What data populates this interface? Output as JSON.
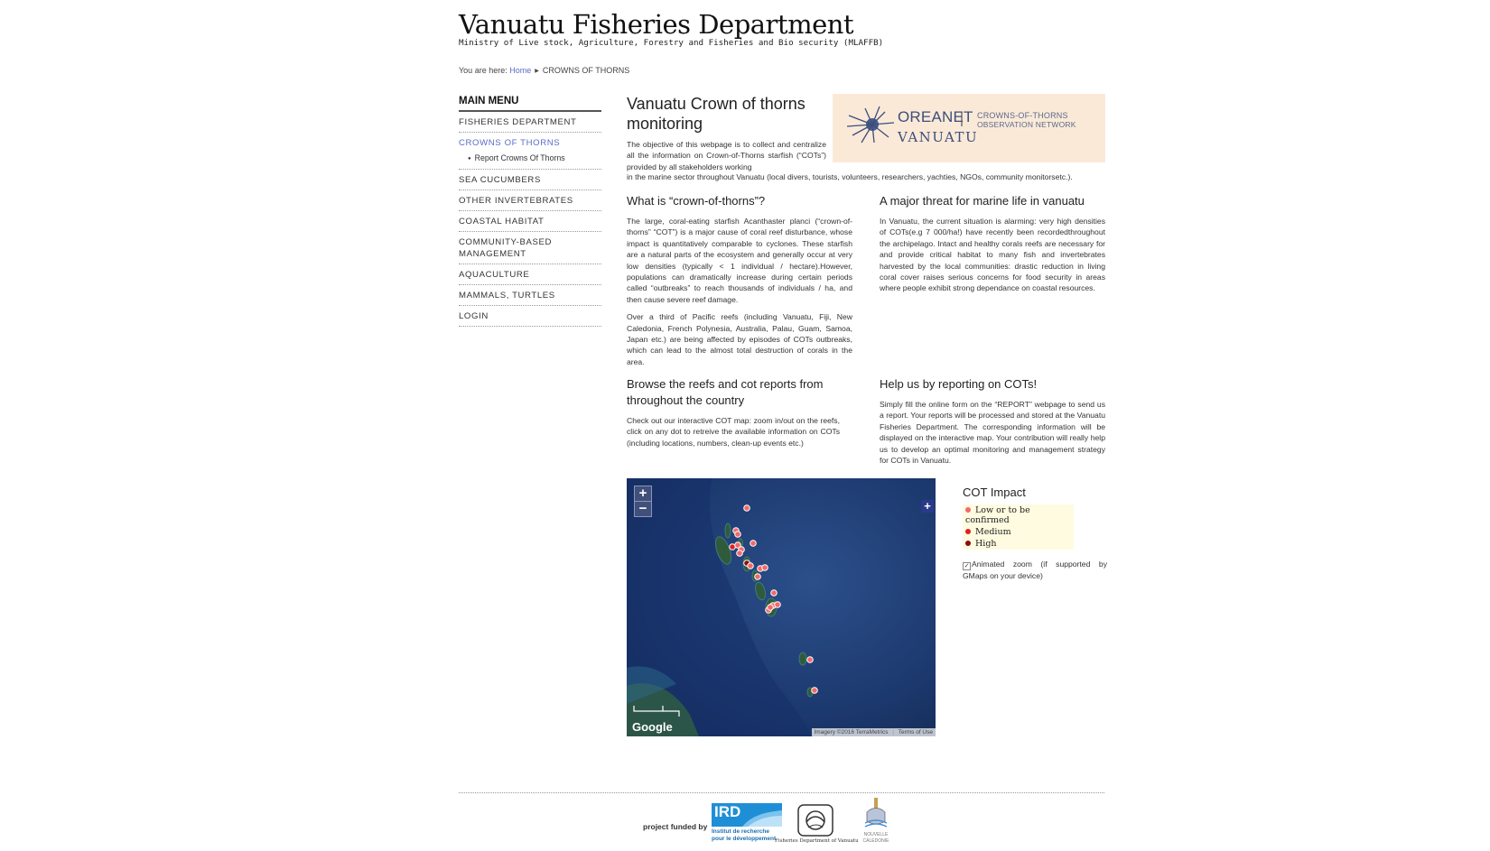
{
  "site": {
    "title": "Vanuatu Fisheries Department",
    "subtitle": "Ministry of Live stock, Agriculture, Forestry and Fisheries and Bio security (MLAFFB)"
  },
  "breadcrumb": {
    "prefix": "You are here:",
    "home": "Home",
    "current": "CROWNS OF THORNS"
  },
  "sidebar": {
    "title": "MAIN MENU",
    "items": [
      {
        "label": "FISHERIES DEPARTMENT"
      },
      {
        "label": "CROWNS OF THORNS",
        "active": true
      },
      {
        "label": "SEA CUCUMBERS"
      },
      {
        "label": "OTHER INVERTEBRATES"
      },
      {
        "label": "COASTAL HABITAT"
      },
      {
        "label": "COMMUNITY-BASED MANAGEMENT"
      },
      {
        "label": "AQUACULTURE"
      },
      {
        "label": "MAMMALS, TURTLES"
      },
      {
        "label": "LOGIN"
      }
    ],
    "subitem": "Report Crowns Of Thorns"
  },
  "main": {
    "title": "Vanuatu Crown of thorns monitoring",
    "logo": {
      "name": "OREANET",
      "country": "VANUATU",
      "tagline1": "CROWNS-OF-THORNS",
      "tagline2": "OBSERVATION NETWORK"
    },
    "intro": "The objective of this webpage is to collect and centralize all the information on Crown-of-Thorns starfish (“COTs”) provided by all stakeholders working",
    "intro_tail": "in the marine sector throughout Vanuatu (local divers, tourists, volunteers, researchers, yachties, NGOs, community monitorsetc.).",
    "sections": [
      {
        "heading": "What is “crown-of-thorns”?",
        "paragraphs": [
          "The large, coral-eating starfish Acanthaster planci (“crown-of-thorns” “COT”) is a major cause of coral reef disturbance, whose impact is quantitatively comparable to cyclones. These starfish are a natural parts of the ecosystem and generally occur at very low densities (typically < 1 individual / hectare).However, populations can dramatically increase during certain periods called “outbreaks” to reach thousands of individuals / ha, and then cause severe reef damage.",
          "Over a third of Pacific reefs (including Vanuatu, Fiji, New Caledonia, French Polynesia, Australia, Palau, Guam, Samoa, Japan etc.) are being affected by episodes of COTs outbreaks, which can lead to the almost total destruction of corals in the area."
        ]
      },
      {
        "heading": "A major threat for marine life in vanuatu",
        "paragraphs": [
          "In Vanuatu, the current situation is alarming: very high densities of COTs(e.g 7 000/ha!) have recently been recordedthroughout the archipelago. Intact and healthy corals reefs are necessary for and provide critical habitat to many fish and invertebrates harvested by the local communities: drastic reduction in living coral cover raises serious concerns for food security in areas where people exhibit strong dependance on coastal resources."
        ]
      },
      {
        "heading": "Browse the reefs and cot reports from throughout the country",
        "paragraphs": [
          "Check out our interactive COT map: zoom in/out on the reefs, click on any dot to retreive the available information on COTs (including locations, numbers, clean-up events etc.)"
        ]
      },
      {
        "heading": "Help us by reporting on COTs!",
        "paragraphs": [
          "Simply fill the online form on the “REPORT” webpage to send us a report. Your reports will be processed and stored at the Vanuatu Fisheries Department. The corresponding information will be displayed on the interactive map. Your contribution will really help us to develop an optimal monitoring and management strategy for COTs in Vanuatu."
        ]
      }
    ]
  },
  "map": {
    "zoom_in": "+",
    "zoom_out": "−",
    "fullscreen": "+",
    "google": "Google",
    "attribution": "Imagery ©2016 TerraMetrics",
    "terms": "Terms of Use"
  },
  "legend": {
    "title": "COT Impact",
    "items": [
      {
        "label": "Low or to be confirmed",
        "color": "#f06a6a"
      },
      {
        "label": "Medium",
        "color": "#e02020"
      },
      {
        "label": "High",
        "color": "#8a0c0c"
      }
    ],
    "animated_zoom": "Animated zoom (if supported by GMaps on your device)"
  },
  "footer": {
    "funded": "project funded by",
    "ird_name": "IRD",
    "ird_text1": "Institut de recherche",
    "ird_text2": "pour le développement",
    "vfd_caption": "Fisheries Department of Vanuatu",
    "nc_caption1": "NOUVELLE",
    "nc_caption2": "CALEDONIE"
  },
  "colors": {
    "link": "#5a6bc4",
    "logo_bg": "#fbe9d8",
    "legend_bg": "#fffbe0"
  }
}
